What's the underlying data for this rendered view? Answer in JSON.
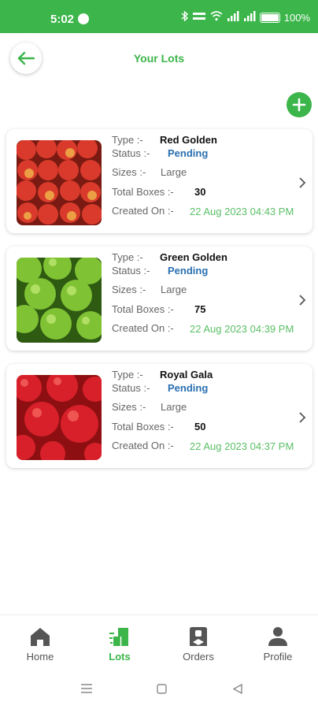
{
  "status_bar": {
    "time": "5:02",
    "battery": "100%",
    "icons": [
      "bluetooth-icon",
      "data-rate-icon",
      "wifi-icon",
      "signal-icon",
      "signal-icon",
      "battery-icon"
    ]
  },
  "header": {
    "title": "Your Lots",
    "back_icon": "arrow-left-icon",
    "add_icon": "plus-icon"
  },
  "colors": {
    "primary": "#3cb54a",
    "status": "#2a6fb0",
    "date": "#5bbf66"
  },
  "labels": {
    "type": "Type :-",
    "status": "Status :-",
    "sizes": "Sizes :-",
    "total_boxes": "Total Boxes :-",
    "created_on": "Created On :-"
  },
  "lots": [
    {
      "type": "Red Golden",
      "status": "Pending",
      "sizes": "Large",
      "total_boxes": "30",
      "created_on": "22 Aug 2023 04:43 PM",
      "image": "red-golden-apples"
    },
    {
      "type": "Green Golden",
      "status": "Pending",
      "sizes": "Large",
      "total_boxes": "75",
      "created_on": "22 Aug 2023 04:39 PM",
      "image": "green-golden-apples"
    },
    {
      "type": "Royal Gala",
      "status": "Pending",
      "sizes": "Large",
      "total_boxes": "50",
      "created_on": "22 Aug 2023 04:37 PM",
      "image": "royal-gala-apples"
    }
  ],
  "bottom_nav": [
    {
      "label": "Home",
      "icon": "home-icon",
      "active": false
    },
    {
      "label": "Lots",
      "icon": "boxes-icon",
      "active": true
    },
    {
      "label": "Orders",
      "icon": "orders-icon",
      "active": false
    },
    {
      "label": "Profile",
      "icon": "person-icon",
      "active": false
    }
  ]
}
